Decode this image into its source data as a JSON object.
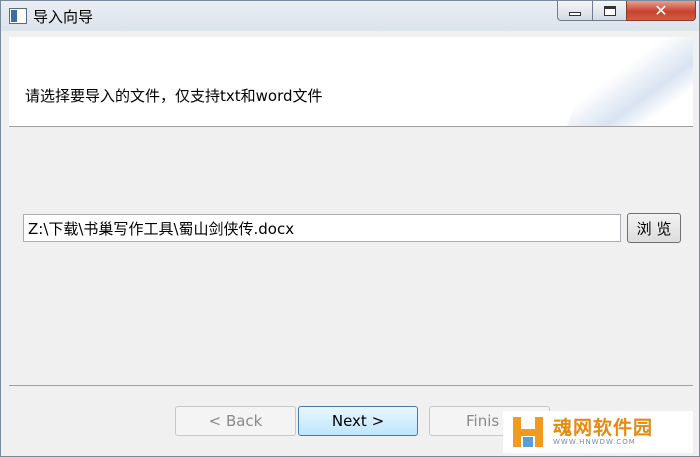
{
  "window": {
    "title": "导入向导"
  },
  "header": {
    "instruction": "请选择要导入的文件，仅支持txt和word文件"
  },
  "file_select": {
    "path_value": "Z:\\下载\\书巢写作工具\\蜀山剑侠传.docx",
    "browse_label": "浏 览"
  },
  "navigation": {
    "back_label": "< Back",
    "next_label": "Next >",
    "finish_label": "Finis"
  },
  "watermark": {
    "brand": "魂网软件园",
    "url": "WWW.HNWDW.COM"
  },
  "icons": {
    "app": "wizard-window-icon",
    "minimize": "minimize-icon",
    "maximize": "maximize-icon",
    "close": "close-icon"
  },
  "colors": {
    "next_button_border": "#3c7fb1",
    "close_button": "#c7432e",
    "watermark_orange": "#e58a12"
  }
}
